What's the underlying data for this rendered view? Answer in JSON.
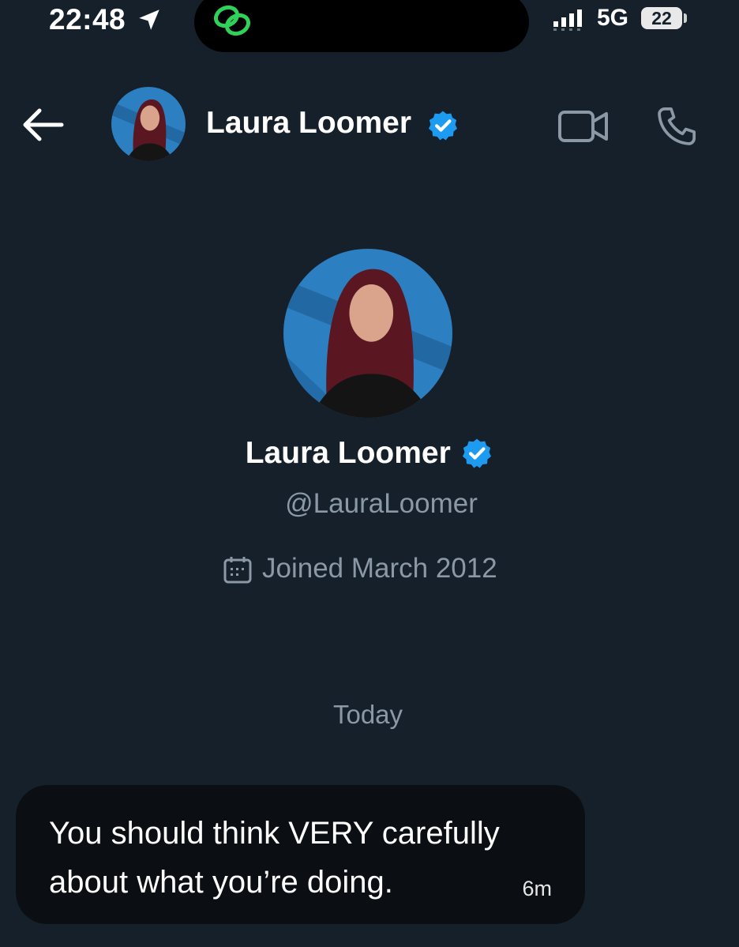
{
  "status_bar": {
    "time": "22:48",
    "network": "5G",
    "battery": "22"
  },
  "header": {
    "name": "Laura Loomer",
    "icons": [
      "back-arrow-icon",
      "verified-badge-icon",
      "video-call-icon",
      "phone-call-icon"
    ]
  },
  "profile": {
    "name": "Laura Loomer",
    "handle": "@LauraLoomer",
    "joined": "Joined March 2012"
  },
  "conversation": {
    "date_separator": "Today",
    "messages": [
      {
        "text": "You should think VERY carefully about what you’re doing.",
        "time": "6m"
      }
    ]
  },
  "colors": {
    "background": "#15202b",
    "verified": "#1d9bf0",
    "muted_text": "#8b98a5",
    "bubble": "#0b0e12",
    "link_icon": "#30d158"
  }
}
